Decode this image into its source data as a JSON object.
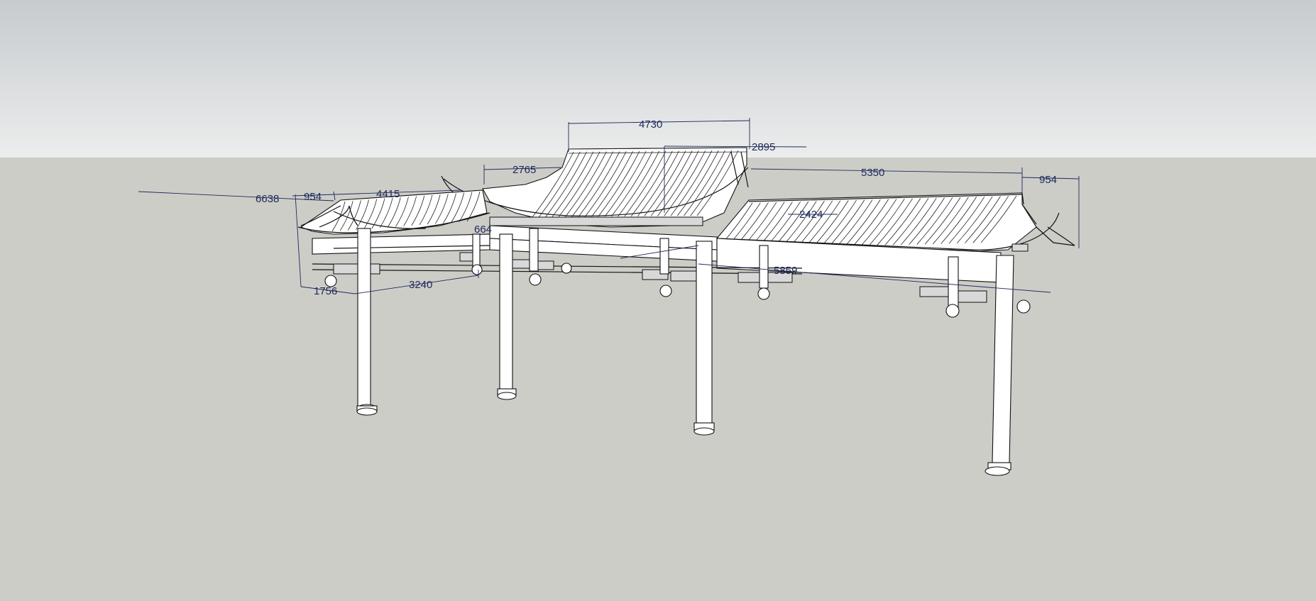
{
  "viewport": {
    "sky_top_color": "#c7cbce",
    "sky_bottom_color": "#eceded",
    "ground_color": "#cdcdc8",
    "model_line_color": "#111111",
    "dimension_color": "#1e2a5a"
  },
  "dimensions": {
    "d4730": "4730",
    "d2895": "2895",
    "d2765": "2765",
    "d5350": "5350",
    "d954_right": "954",
    "d6638": "6638",
    "d954_left": "954",
    "d4415": "4415",
    "d664": "664",
    "d2424": "2424",
    "d5859": "5859",
    "d1756": "1756",
    "d3240": "3240"
  }
}
